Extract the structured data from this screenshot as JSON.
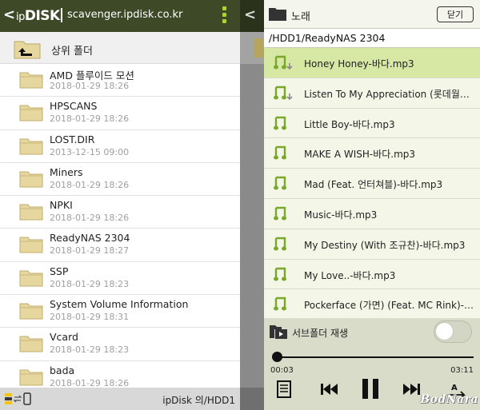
{
  "left_panel": {
    "header": {
      "back_label": "<",
      "brand_prefix": "ip",
      "brand_name": "DISK",
      "host": "scavenger.ipdisk.co.kr"
    },
    "parent_folder_label": "상위 폴더",
    "folders": [
      {
        "name": "AMD 플루이드 모션",
        "date": "2018-01-29 18:26"
      },
      {
        "name": "HPSCANS",
        "date": "2018-01-29 18:26"
      },
      {
        "name": "LOST.DIR",
        "date": "2013-12-15 09:00"
      },
      {
        "name": "Miners",
        "date": "2018-01-29 18:26"
      },
      {
        "name": "NPKI",
        "date": "2018-01-29 18:26"
      },
      {
        "name": "ReadyNAS 2304",
        "date": "2018-01-29 18:27"
      },
      {
        "name": "SSP",
        "date": "2018-01-29 18:23"
      },
      {
        "name": "System Volume Information",
        "date": "2018-01-29 18:31"
      },
      {
        "name": "Vcard",
        "date": "2018-01-29 18:23"
      },
      {
        "name": "bada",
        "date": "2018-01-29 18:26"
      }
    ],
    "footer": {
      "location": "ipDisk 의/HDD1"
    }
  },
  "middle_strip": {
    "back_label": "<"
  },
  "player_panel": {
    "title": "노래",
    "close_label": "닫기",
    "path": "/HDD1/ReadyNAS 2304",
    "tracks": [
      {
        "name": "Honey Honey-바다.mp3",
        "downloaded": false,
        "active": true
      },
      {
        "name": "Listen To My Appreciation (롯데월…",
        "downloaded": false,
        "active": false
      },
      {
        "name": "Little Boy-바다.mp3",
        "downloaded": true,
        "active": false
      },
      {
        "name": "MAKE A WISH-바다.mp3",
        "downloaded": true,
        "active": false
      },
      {
        "name": "Mad (Feat. 언터쳐블)-바다.mp3",
        "downloaded": true,
        "active": false
      },
      {
        "name": "Music-바다.mp3",
        "downloaded": true,
        "active": false
      },
      {
        "name": "My Destiny (With 조규찬)-바다.mp3",
        "downloaded": true,
        "active": false
      },
      {
        "name": "My Love..-바다.mp3",
        "downloaded": true,
        "active": false
      },
      {
        "name": "Pockerface (가면) (Feat. MC Rink)-…",
        "downloaded": true,
        "active": false
      }
    ],
    "subfolder_play_label": "서브폴더 재생",
    "subfolder_play_on": false,
    "current_time": "00:03",
    "total_time": "03:11",
    "progress_fraction": 0.016,
    "watermark": "BodNara"
  },
  "colors": {
    "header_bg": "#3e4a27",
    "accent": "#b3d232",
    "active_track": "#d6e8a3",
    "folder": "#e6d79e"
  }
}
